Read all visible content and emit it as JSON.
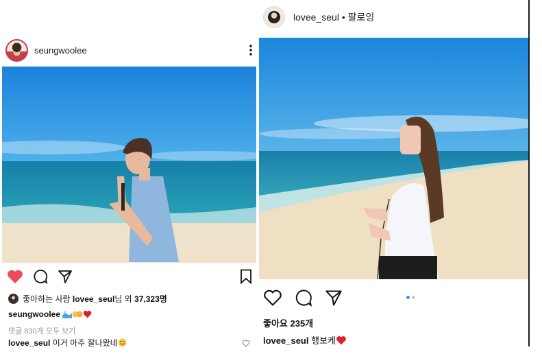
{
  "left_post": {
    "username": "seungwoolee",
    "likes_line": {
      "prefix": "좋아하는 사람 ",
      "liker": "lovee_seul",
      "suffix": "님 외 ",
      "count": "37,323명"
    },
    "caption_user": "seungwoolee",
    "comments_link": "댓글 830개 모두 보기",
    "comment": {
      "user": "lovee_seul",
      "text": " 이거 아주 잘나왔네"
    }
  },
  "right_post": {
    "username": "lovee_seul",
    "follow_status": "• 팔로잉",
    "likes": "좋아요 235개",
    "caption_user": "lovee_seul",
    "caption_text": " 행보케"
  },
  "colors": {
    "like_red": "#ed4956",
    "sky": "#1e8fe0",
    "sea": "#1a8fb5",
    "sand": "#efe2c8",
    "dot_active": "#3897f0",
    "dot_inactive": "#c7c7c7"
  },
  "icons": [
    "heart-icon",
    "comment-icon",
    "share-icon",
    "bookmark-icon",
    "more-options-icon"
  ]
}
